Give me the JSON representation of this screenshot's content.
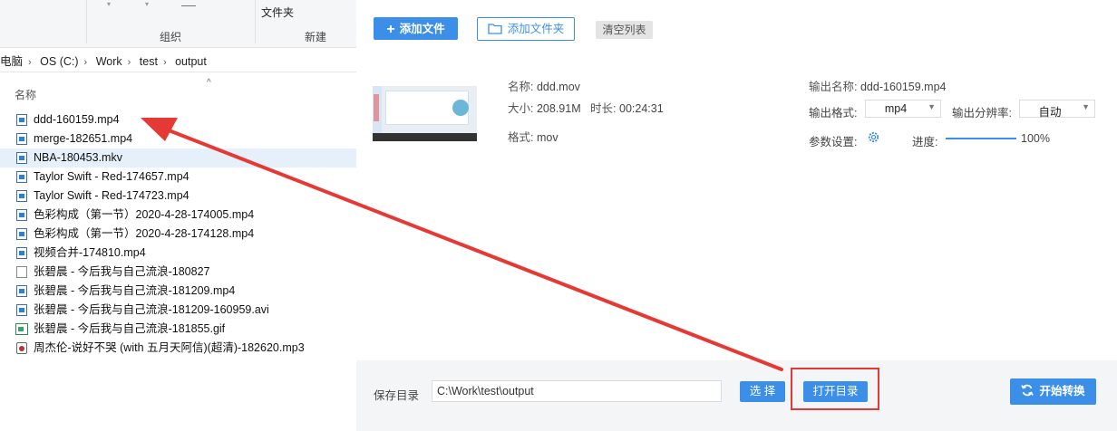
{
  "explorer": {
    "ribbon": {
      "top_label": "文件夹",
      "group_organize": "组织",
      "group_new": "新建"
    },
    "breadcrumb": [
      "电脑",
      "OS (C:)",
      "Work",
      "test",
      "output"
    ],
    "column_name": "名称",
    "files": [
      {
        "name": "ddd-160159.mp4",
        "type": "video"
      },
      {
        "name": "merge-182651.mp4",
        "type": "video"
      },
      {
        "name": "NBA-180453.mkv",
        "type": "video",
        "selected": true
      },
      {
        "name": "Taylor Swift - Red-174657.mp4",
        "type": "video"
      },
      {
        "name": "Taylor Swift - Red-174723.mp4",
        "type": "video"
      },
      {
        "name": "色彩构成（第一节）2020-4-28-174005.mp4",
        "type": "video"
      },
      {
        "name": "色彩构成（第一节）2020-4-28-174128.mp4",
        "type": "video"
      },
      {
        "name": "视频合并-174810.mp4",
        "type": "video"
      },
      {
        "name": "张碧晨 - 今后我与自己流浪-180827",
        "type": "doc"
      },
      {
        "name": "张碧晨 - 今后我与自己流浪-181209.mp4",
        "type": "video"
      },
      {
        "name": "张碧晨 - 今后我与自己流浪-181209-160959.avi",
        "type": "video"
      },
      {
        "name": "张碧晨 - 今后我与自己流浪-181855.gif",
        "type": "gif"
      },
      {
        "name": "周杰伦-说好不哭 (with 五月天阿信)(超清)-182620.mp3",
        "type": "mp3"
      }
    ]
  },
  "toolbar": {
    "add_file": "添加文件",
    "add_folder": "添加文件夹",
    "clear_list": "清空列表"
  },
  "item": {
    "name_label": "名称:",
    "name_value": "ddd.mov",
    "size_label": "大小:",
    "size_value": "208.91M",
    "duration_label": "时长:",
    "duration_value": "00:24:31",
    "format_label": "格式:",
    "format_value": "mov",
    "output_name_label": "输出名称:",
    "output_name_value": "ddd-160159.mp4",
    "output_format_label": "输出格式:",
    "output_format_value": "mp4",
    "output_resolution_label": "输出分辨率:",
    "output_resolution_value": "自动",
    "params_label": "参数设置:",
    "progress_label": "进度:",
    "progress_value": "100%",
    "progress_fraction": 1.0
  },
  "footer": {
    "save_dir_label": "保存目录",
    "save_dir_value": "C:\\Work\\test\\output",
    "choose_button": "选 择",
    "open_dir_button": "打开目录",
    "start_button": "开始转换"
  },
  "colors": {
    "accent": "#3c8fe8",
    "annotation": "#e53935",
    "selection": "#e5f0fb"
  }
}
